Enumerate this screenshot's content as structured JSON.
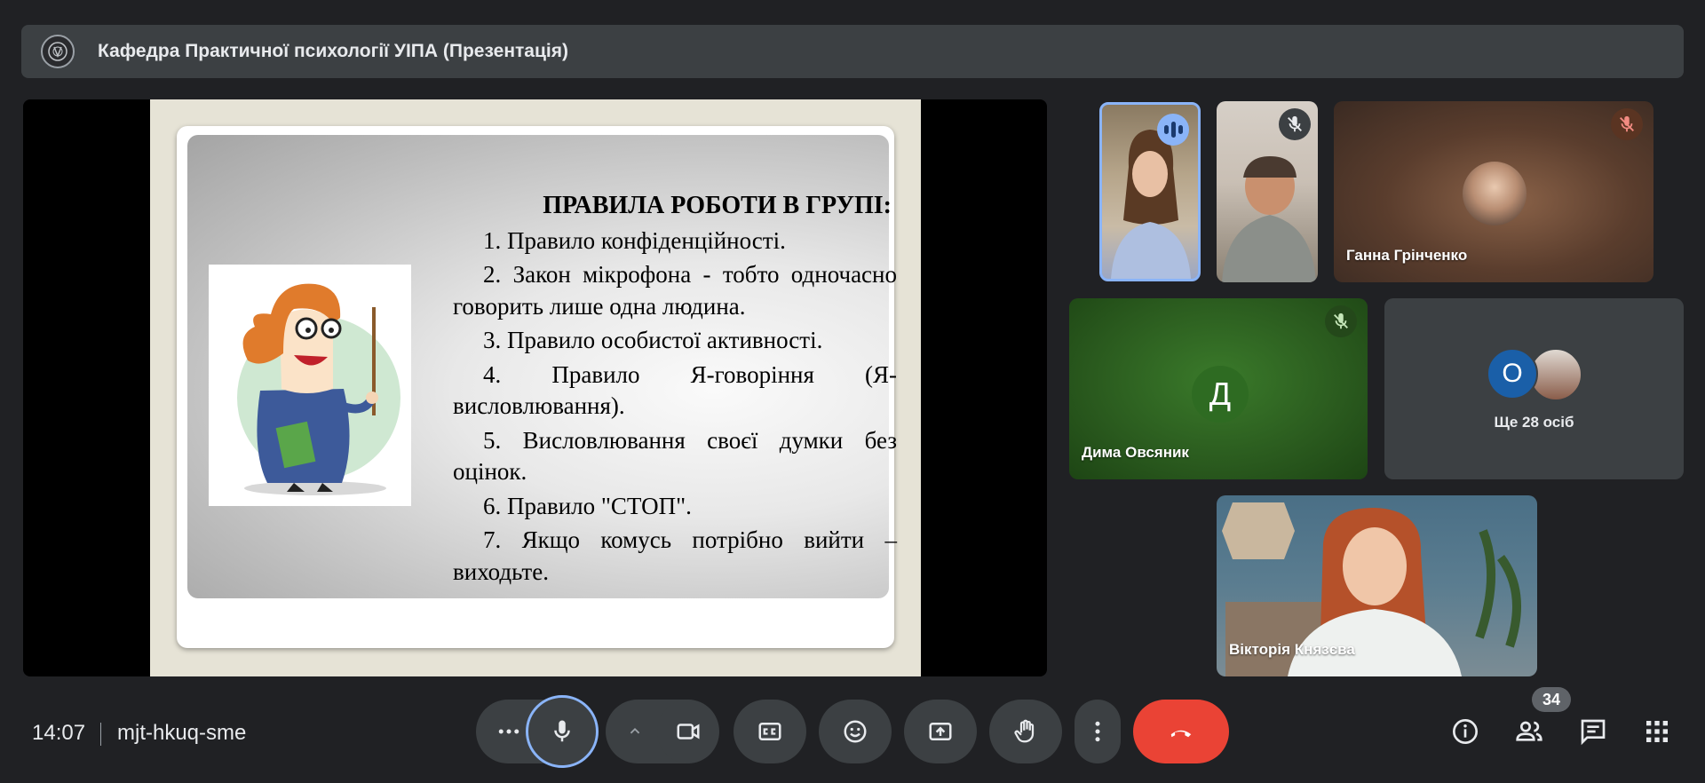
{
  "header": {
    "title": "Кафедра Практичної психології УІПА (Презентація)"
  },
  "slide": {
    "heading": "ПРАВИЛА РОБОТИ В ГРУПІ:",
    "rules": [
      "1. Правило конфіденційності.",
      "2. Закон мікрофона - тобто одночасно говорить лише одна людина.",
      "3. Правило особистої активності.",
      "4. Правило Я-говоріння (Я-висловлювання).",
      "5. Висловлювання своєї думки без оцінок.",
      "6. Правило \"СТОП\".",
      "7. Якщо комусь потрібно вийти – виходьте."
    ]
  },
  "participants": {
    "tile_ganna": {
      "name": "Ганна Грінченко"
    },
    "tile_dyma": {
      "name": "Дима Овсяник",
      "initial": "Д"
    },
    "tile_more": {
      "initial": "О",
      "label": "Ще 28 осіб"
    },
    "tile_viktoria": {
      "name": "Вікторія Князєва"
    }
  },
  "bottom_bar": {
    "time": "14:07",
    "meeting_code": "mjt-hkuq-sme",
    "participant_count": "34"
  },
  "colors": {
    "accent": "#8ab4f8",
    "end_call": "#ea4335",
    "control_bg": "#3c4043",
    "page_bg": "#202124"
  },
  "icons": [
    "logo-icon",
    "speaking-icon",
    "mic-off-icon",
    "more-horiz-icon",
    "mic-icon",
    "caret-up-icon",
    "camera-icon",
    "captions-icon",
    "emoji-icon",
    "present-icon",
    "raise-hand-icon",
    "more-vert-icon",
    "end-call-icon",
    "info-icon",
    "people-icon",
    "chat-icon",
    "apps-icon"
  ]
}
